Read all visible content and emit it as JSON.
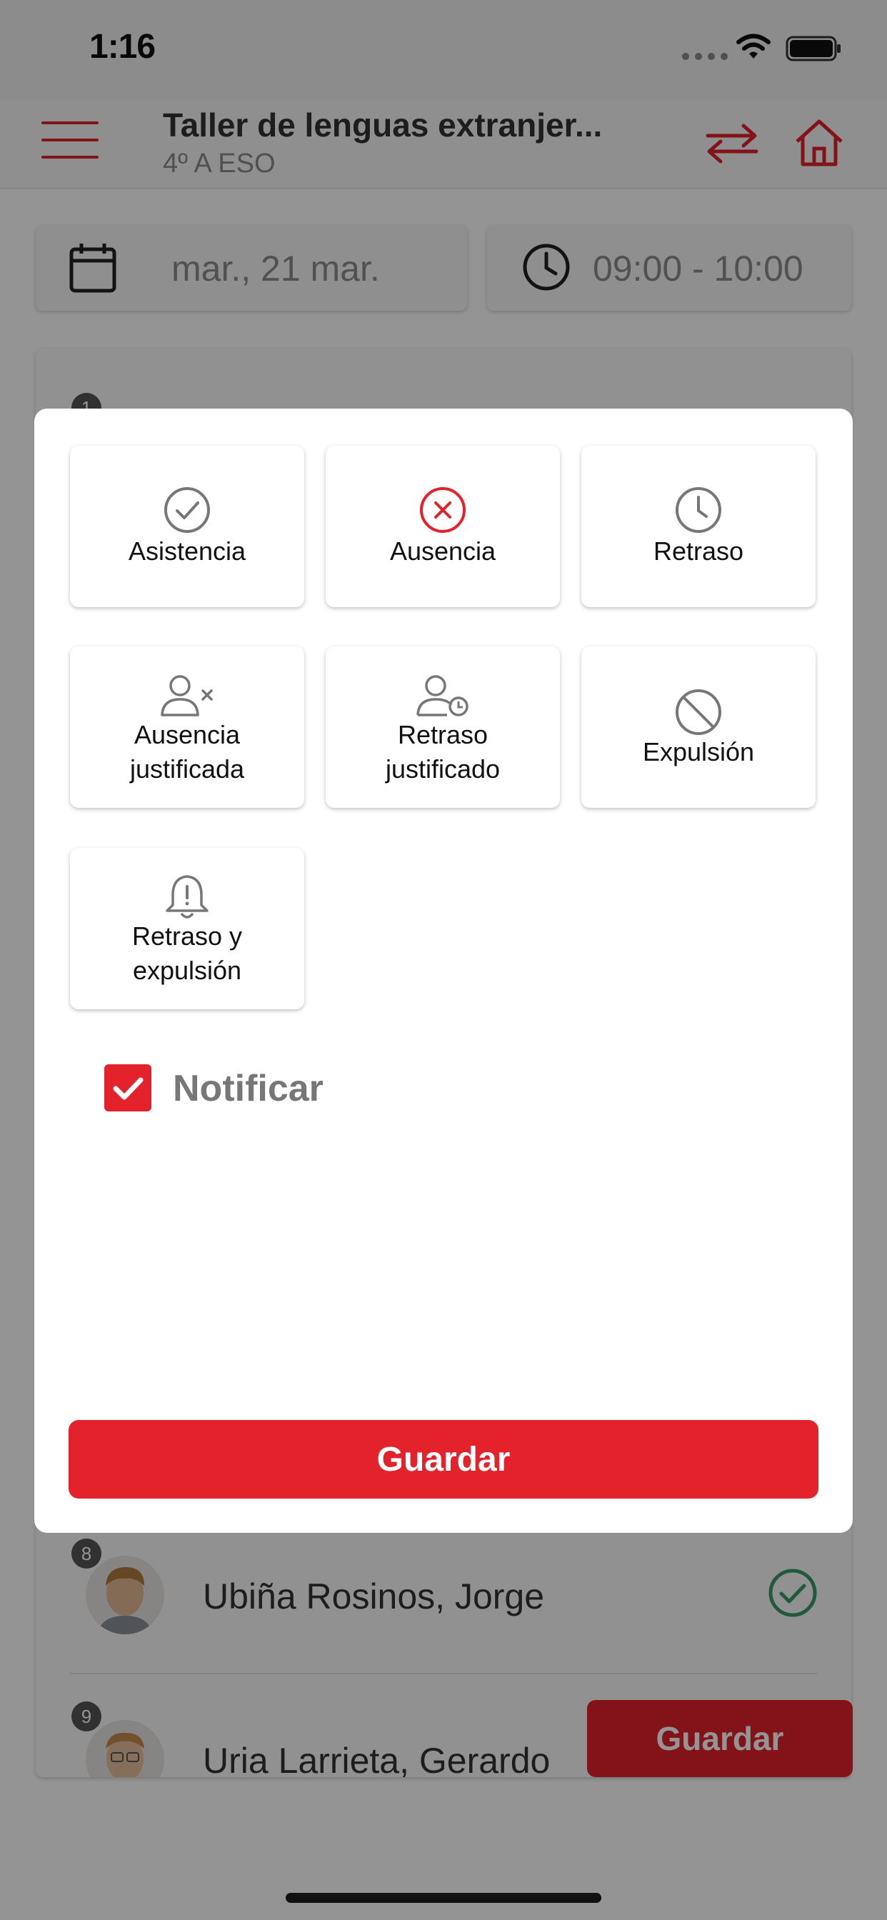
{
  "status_bar": {
    "time": "1:16"
  },
  "header": {
    "title": "Taller de lenguas extranjer...",
    "subtitle": "4º A ESO"
  },
  "filters": {
    "date": "mar., 21 mar.",
    "time_range": "09:00 - 10:00"
  },
  "students": [
    {
      "number": "1"
    },
    {
      "number": "8",
      "name": "Ubiña Rosinos, Jorge",
      "status": "attendance"
    },
    {
      "number": "9",
      "name": "Uria Larrieta, Gerardo"
    }
  ],
  "background_save_label": "Guardar",
  "attendance_options": [
    {
      "label": "Asistencia",
      "icon": "check-circle-icon"
    },
    {
      "label": "Ausencia",
      "icon": "x-circle-icon"
    },
    {
      "label": "Retraso",
      "icon": "clock-icon"
    },
    {
      "label": "Ausencia justificada",
      "icon": "user-x-icon"
    },
    {
      "label": "Retraso justificado",
      "icon": "user-clock-icon"
    },
    {
      "label": "Expulsión",
      "icon": "prohibited-icon"
    },
    {
      "label": "Retraso y expulsión",
      "icon": "bell-alert-icon"
    }
  ],
  "notify": {
    "label": "Notificar",
    "checked": true
  },
  "save_label": "Guardar",
  "colors": {
    "accent": "#e4222b",
    "check_green": "#3a9a6a",
    "icon_gray": "#777777"
  }
}
